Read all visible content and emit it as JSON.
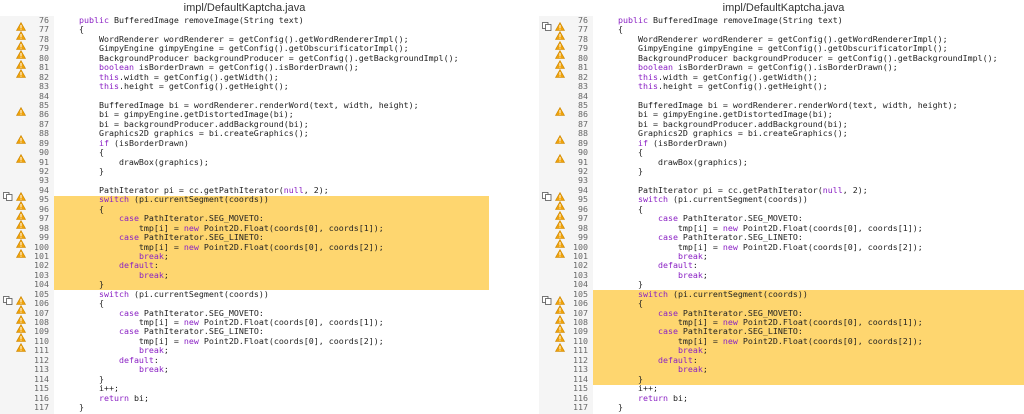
{
  "left": {
    "title": "impl/DefaultKaptcha.java",
    "highlight": {
      "from": 95,
      "to": 104
    },
    "lines": [
      {
        "n": "76",
        "icons": [
          "warn"
        ],
        "text": "    public BufferedImage removeImage(String text)"
      },
      {
        "n": "77",
        "icons": [
          "warn"
        ],
        "text": "    {"
      },
      {
        "n": "78",
        "icons": [
          "warn"
        ],
        "text": "        WordRenderer wordRenderer = getConfig().getWordRendererImpl();"
      },
      {
        "n": "79",
        "icons": [
          "warn"
        ],
        "text": "        GimpyEngine gimpyEngine = getConfig().getObscurificatorImpl();"
      },
      {
        "n": "80",
        "icons": [
          "warn"
        ],
        "text": "        BackgroundProducer backgroundProducer = getConfig().getBackgroundImpl();"
      },
      {
        "n": "81",
        "icons": [
          "warn"
        ],
        "text": "        boolean isBorderDrawn = getConfig().isBorderDrawn();"
      },
      {
        "n": "82",
        "icons": [],
        "text": "        this.width = getConfig().getWidth();"
      },
      {
        "n": "83",
        "icons": [],
        "text": "        this.height = getConfig().getHeight();"
      },
      {
        "n": "84",
        "icons": [],
        "text": ""
      },
      {
        "n": "85",
        "icons": [
          "warn"
        ],
        "text": "        BufferedImage bi = wordRenderer.renderWord(text, width, height);"
      },
      {
        "n": "86",
        "icons": [],
        "text": "        bi = gimpyEngine.getDistortedImage(bi);"
      },
      {
        "n": "87",
        "icons": [],
        "text": "        bi = backgroundProducer.addBackground(bi);"
      },
      {
        "n": "88",
        "icons": [
          "warn"
        ],
        "text": "        Graphics2D graphics = bi.createGraphics();"
      },
      {
        "n": "89",
        "icons": [],
        "text": "        if (isBorderDrawn)"
      },
      {
        "n": "90",
        "icons": [
          "warn"
        ],
        "text": "        {"
      },
      {
        "n": "91",
        "icons": [],
        "text": "            drawBox(graphics);"
      },
      {
        "n": "92",
        "icons": [],
        "text": "        }"
      },
      {
        "n": "93",
        "icons": [],
        "text": ""
      },
      {
        "n": "94",
        "icons": [
          "dup",
          "warn"
        ],
        "text": "        PathIterator pi = cc.getPathIterator(null, 2);"
      },
      {
        "n": "95",
        "icons": [
          "warn"
        ],
        "text": "        switch (pi.currentSegment(coords))"
      },
      {
        "n": "96",
        "icons": [
          "warn"
        ],
        "text": "        {"
      },
      {
        "n": "97",
        "icons": [
          "warn"
        ],
        "text": "            case PathIterator.SEG_MOVETO:"
      },
      {
        "n": "98",
        "icons": [
          "warn"
        ],
        "text": "                tmp[i] = new Point2D.Float(coords[0], coords[1]);"
      },
      {
        "n": "99",
        "icons": [
          "warn"
        ],
        "text": "            case PathIterator.SEG_LINETO:"
      },
      {
        "n": "100",
        "icons": [
          "warn"
        ],
        "text": "                tmp[i] = new Point2D.Float(coords[0], coords[2]);"
      },
      {
        "n": "101",
        "icons": [],
        "text": "                break;"
      },
      {
        "n": "102",
        "icons": [],
        "text": "            default:"
      },
      {
        "n": "103",
        "icons": [],
        "text": "                break;"
      },
      {
        "n": "104",
        "icons": [],
        "text": "        }"
      },
      {
        "n": "105",
        "icons": [
          "dup",
          "warn"
        ],
        "text": "        switch (pi.currentSegment(coords))"
      },
      {
        "n": "106",
        "icons": [
          "warn"
        ],
        "text": "        {"
      },
      {
        "n": "107",
        "icons": [
          "warn"
        ],
        "text": "            case PathIterator.SEG_MOVETO:"
      },
      {
        "n": "108",
        "icons": [
          "warn"
        ],
        "text": "                tmp[i] = new Point2D.Float(coords[0], coords[1]);"
      },
      {
        "n": "109",
        "icons": [
          "warn"
        ],
        "text": "            case PathIterator.SEG_LINETO:"
      },
      {
        "n": "110",
        "icons": [
          "warn"
        ],
        "text": "                tmp[i] = new Point2D.Float(coords[0], coords[2]);"
      },
      {
        "n": "111",
        "icons": [],
        "text": "                break;"
      },
      {
        "n": "112",
        "icons": [],
        "text": "            default:"
      },
      {
        "n": "113",
        "icons": [],
        "text": "                break;"
      },
      {
        "n": "114",
        "icons": [],
        "text": "        }"
      },
      {
        "n": "115",
        "icons": [],
        "text": "        i++;"
      },
      {
        "n": "116",
        "icons": [],
        "text": "        return bi;"
      },
      {
        "n": "117",
        "icons": [],
        "text": "    }"
      }
    ]
  },
  "right": {
    "title": "impl/DefaultKaptcha.java",
    "highlight": {
      "from": 105,
      "to": 114
    },
    "lines": [
      {
        "n": "76",
        "icons": [
          "dup",
          "warn"
        ],
        "text": "    public BufferedImage removeImage(String text)"
      },
      {
        "n": "77",
        "icons": [
          "warn"
        ],
        "text": "    {"
      },
      {
        "n": "78",
        "icons": [
          "warn"
        ],
        "text": "        WordRenderer wordRenderer = getConfig().getWordRendererImpl();"
      },
      {
        "n": "79",
        "icons": [
          "warn"
        ],
        "text": "        GimpyEngine gimpyEngine = getConfig().getObscurificatorImpl();"
      },
      {
        "n": "80",
        "icons": [
          "warn"
        ],
        "text": "        BackgroundProducer backgroundProducer = getConfig().getBackgroundImpl();"
      },
      {
        "n": "81",
        "icons": [
          "warn"
        ],
        "text": "        boolean isBorderDrawn = getConfig().isBorderDrawn();"
      },
      {
        "n": "82",
        "icons": [],
        "text": "        this.width = getConfig().getWidth();"
      },
      {
        "n": "83",
        "icons": [],
        "text": "        this.height = getConfig().getHeight();"
      },
      {
        "n": "84",
        "icons": [],
        "text": ""
      },
      {
        "n": "85",
        "icons": [
          "warn"
        ],
        "text": "        BufferedImage bi = wordRenderer.renderWord(text, width, height);"
      },
      {
        "n": "86",
        "icons": [],
        "text": "        bi = gimpyEngine.getDistortedImage(bi);"
      },
      {
        "n": "87",
        "icons": [],
        "text": "        bi = backgroundProducer.addBackground(bi);"
      },
      {
        "n": "88",
        "icons": [
          "warn"
        ],
        "text": "        Graphics2D graphics = bi.createGraphics();"
      },
      {
        "n": "89",
        "icons": [],
        "text": "        if (isBorderDrawn)"
      },
      {
        "n": "90",
        "icons": [
          "warn"
        ],
        "text": "        {"
      },
      {
        "n": "91",
        "icons": [],
        "text": "            drawBox(graphics);"
      },
      {
        "n": "92",
        "icons": [],
        "text": "        }"
      },
      {
        "n": "93",
        "icons": [],
        "text": ""
      },
      {
        "n": "94",
        "icons": [
          "dup",
          "warn"
        ],
        "text": "        PathIterator pi = cc.getPathIterator(null, 2);"
      },
      {
        "n": "95",
        "icons": [
          "warn"
        ],
        "text": "        switch (pi.currentSegment(coords))"
      },
      {
        "n": "96",
        "icons": [
          "warn"
        ],
        "text": "        {"
      },
      {
        "n": "97",
        "icons": [
          "warn"
        ],
        "text": "            case PathIterator.SEG_MOVETO:"
      },
      {
        "n": "98",
        "icons": [
          "warn"
        ],
        "text": "                tmp[i] = new Point2D.Float(coords[0], coords[1]);"
      },
      {
        "n": "99",
        "icons": [
          "warn"
        ],
        "text": "            case PathIterator.SEG_LINETO:"
      },
      {
        "n": "100",
        "icons": [
          "warn"
        ],
        "text": "                tmp[i] = new Point2D.Float(coords[0], coords[2]);"
      },
      {
        "n": "101",
        "icons": [],
        "text": "                break;"
      },
      {
        "n": "102",
        "icons": [],
        "text": "            default:"
      },
      {
        "n": "103",
        "icons": [],
        "text": "                break;"
      },
      {
        "n": "104",
        "icons": [],
        "text": "        }"
      },
      {
        "n": "105",
        "icons": [
          "dup",
          "warn"
        ],
        "text": "        switch (pi.currentSegment(coords))"
      },
      {
        "n": "106",
        "icons": [
          "warn"
        ],
        "text": "        {"
      },
      {
        "n": "107",
        "icons": [
          "warn"
        ],
        "text": "            case PathIterator.SEG_MOVETO:"
      },
      {
        "n": "108",
        "icons": [
          "warn"
        ],
        "text": "                tmp[i] = new Point2D.Float(coords[0], coords[1]);"
      },
      {
        "n": "109",
        "icons": [
          "warn"
        ],
        "text": "            case PathIterator.SEG_LINETO:"
      },
      {
        "n": "110",
        "icons": [
          "warn"
        ],
        "text": "                tmp[i] = new Point2D.Float(coords[0], coords[2]);"
      },
      {
        "n": "111",
        "icons": [],
        "text": "                break;"
      },
      {
        "n": "112",
        "icons": [],
        "text": "            default:"
      },
      {
        "n": "113",
        "icons": [],
        "text": "                break;"
      },
      {
        "n": "114",
        "icons": [],
        "text": "        }"
      },
      {
        "n": "115",
        "icons": [],
        "text": "        i++;"
      },
      {
        "n": "116",
        "icons": [],
        "text": "        return bi;"
      },
      {
        "n": "117",
        "icons": [],
        "text": "    }"
      }
    ]
  },
  "colors": {
    "highlight": "#fed66f",
    "keyword": "#8b22c4",
    "warning": "#f0a30a",
    "gutter": "#f5f5f5"
  }
}
